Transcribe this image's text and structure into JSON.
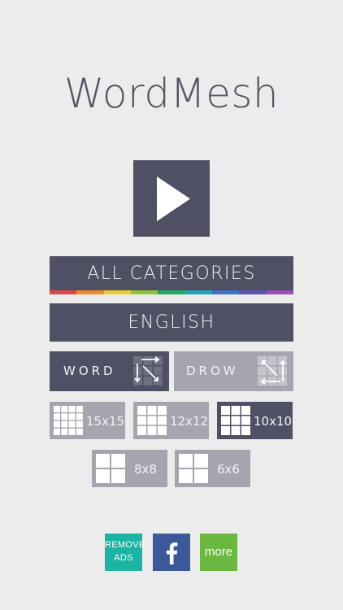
{
  "app": {
    "title": "WordMesh"
  },
  "play": {
    "icon": "play-icon"
  },
  "category": {
    "label": "ALL CATEGORIES",
    "stripe_colors": [
      "#e04545",
      "#ef8a2c",
      "#eacc2f",
      "#8fc43b",
      "#21a860",
      "#21a6b6",
      "#3d74c9",
      "#5a52b6",
      "#9c49ba"
    ]
  },
  "language": {
    "label": "ENGLISH"
  },
  "modes": [
    {
      "label": "WORD",
      "icon": "word-mode-icon",
      "selected": true
    },
    {
      "label": "DROW",
      "icon": "drow-mode-icon",
      "selected": false
    }
  ],
  "sizes": [
    {
      "label": "15x15",
      "grid": 4,
      "selected": false
    },
    {
      "label": "12x12",
      "grid": 3,
      "selected": false
    },
    {
      "label": "10x10",
      "grid": 3,
      "selected": true
    },
    {
      "label": "8x8",
      "grid": 2,
      "selected": false
    },
    {
      "label": "6x6",
      "grid": 2,
      "selected": false
    }
  ],
  "social": {
    "remove_ads_line1": "REMOVE",
    "remove_ads_line2": "ADS",
    "facebook_icon": "facebook-icon",
    "more_label": "more"
  },
  "colors": {
    "background": "#ececec",
    "dark": "#4f5064",
    "light": "#a5a5b0",
    "remove_ads": "#1bb3a2",
    "facebook": "#3b5998",
    "more": "#6ab83f"
  }
}
